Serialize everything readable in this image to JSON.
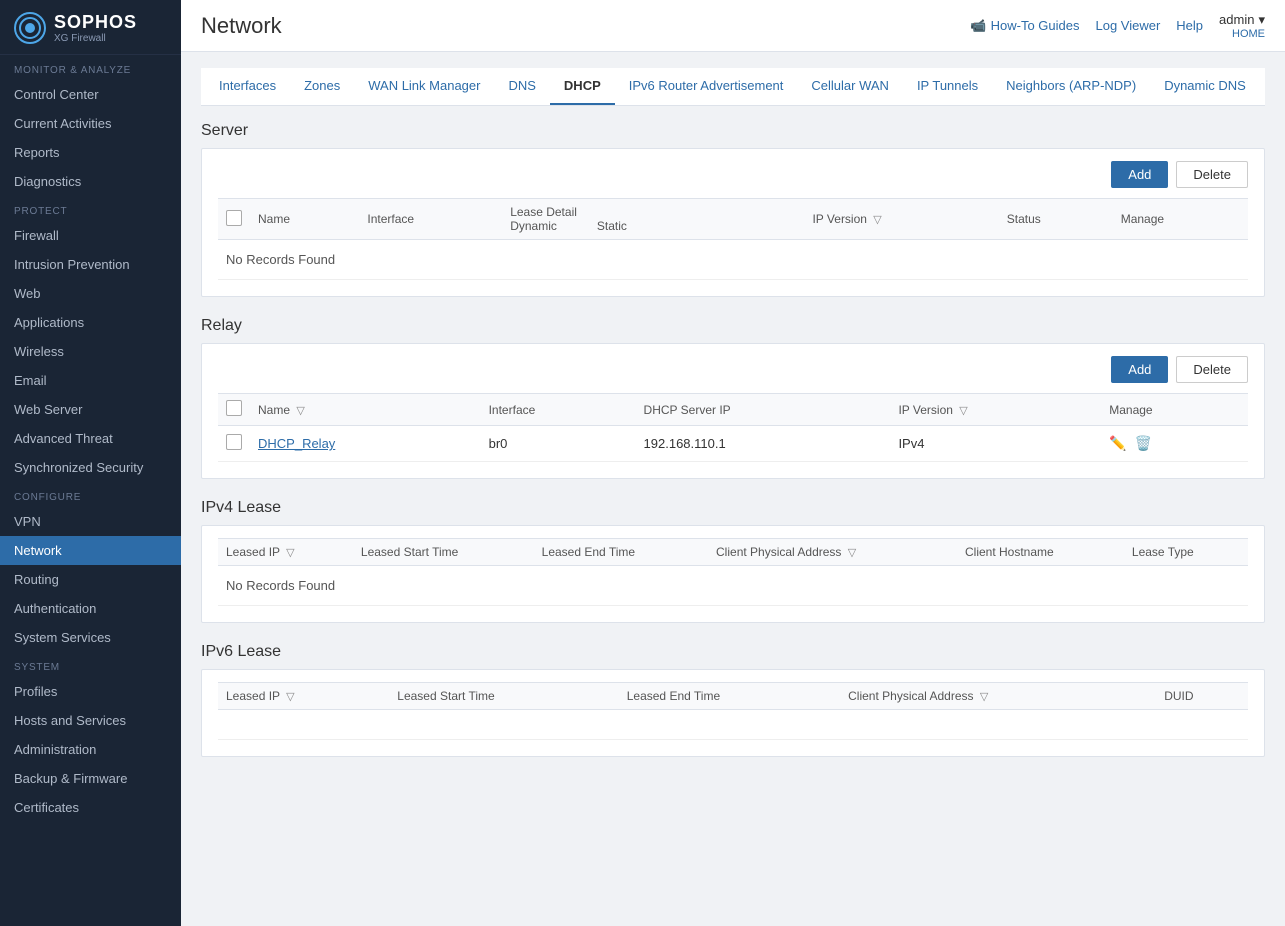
{
  "brand": {
    "name": "SOPHOS",
    "sub": "XG Firewall",
    "icon": "●"
  },
  "topbar": {
    "page_title": "Network",
    "how_to_guides": "How-To Guides",
    "log_viewer": "Log Viewer",
    "help": "Help",
    "admin": "admin",
    "home": "HOME",
    "cam_icon": "📹"
  },
  "sidebar": {
    "sections": [
      {
        "label": "MONITOR & ANALYZE",
        "items": [
          {
            "id": "control-center",
            "label": "Control Center"
          },
          {
            "id": "current-activities",
            "label": "Current Activities"
          },
          {
            "id": "reports",
            "label": "Reports"
          },
          {
            "id": "diagnostics",
            "label": "Diagnostics"
          }
        ]
      },
      {
        "label": "PROTECT",
        "items": [
          {
            "id": "firewall",
            "label": "Firewall"
          },
          {
            "id": "intrusion-prevention",
            "label": "Intrusion Prevention"
          },
          {
            "id": "web",
            "label": "Web"
          },
          {
            "id": "applications",
            "label": "Applications"
          },
          {
            "id": "wireless",
            "label": "Wireless"
          },
          {
            "id": "email",
            "label": "Email"
          },
          {
            "id": "web-server",
            "label": "Web Server"
          },
          {
            "id": "advanced-threat",
            "label": "Advanced Threat"
          },
          {
            "id": "synchronized-security",
            "label": "Synchronized Security"
          }
        ]
      },
      {
        "label": "CONFIGURE",
        "items": [
          {
            "id": "vpn",
            "label": "VPN"
          },
          {
            "id": "network",
            "label": "Network",
            "active": true
          },
          {
            "id": "routing",
            "label": "Routing"
          },
          {
            "id": "authentication",
            "label": "Authentication"
          },
          {
            "id": "system-services",
            "label": "System Services"
          }
        ]
      },
      {
        "label": "SYSTEM",
        "items": [
          {
            "id": "profiles",
            "label": "Profiles"
          },
          {
            "id": "hosts-and-services",
            "label": "Hosts and Services"
          },
          {
            "id": "administration",
            "label": "Administration"
          },
          {
            "id": "backup-firmware",
            "label": "Backup & Firmware"
          },
          {
            "id": "certificates",
            "label": "Certificates"
          }
        ]
      }
    ]
  },
  "tabs": [
    {
      "id": "interfaces",
      "label": "Interfaces"
    },
    {
      "id": "zones",
      "label": "Zones"
    },
    {
      "id": "wan-link-manager",
      "label": "WAN Link Manager"
    },
    {
      "id": "dns",
      "label": "DNS"
    },
    {
      "id": "dhcp",
      "label": "DHCP",
      "active": true
    },
    {
      "id": "ipv6-router",
      "label": "IPv6 Router Advertisement"
    },
    {
      "id": "cellular-wan",
      "label": "Cellular WAN"
    },
    {
      "id": "ip-tunnels",
      "label": "IP Tunnels"
    },
    {
      "id": "neighbors",
      "label": "Neighbors (ARP-NDP)"
    },
    {
      "id": "dynamic-dns",
      "label": "Dynamic DNS"
    }
  ],
  "server": {
    "title": "Server",
    "add_btn": "Add",
    "delete_btn": "Delete",
    "columns": {
      "name": "Name",
      "interface": "Interface",
      "lease_detail": "Lease Detail",
      "dynamic": "Dynamic",
      "static": "Static",
      "ip_version": "IP Version",
      "status": "Status",
      "manage": "Manage"
    },
    "no_records": "No Records Found"
  },
  "relay": {
    "title": "Relay",
    "add_btn": "Add",
    "delete_btn": "Delete",
    "columns": {
      "name": "Name",
      "interface": "Interface",
      "dhcp_server_ip": "DHCP Server IP",
      "ip_version": "IP Version",
      "manage": "Manage"
    },
    "rows": [
      {
        "name": "DHCP_Relay",
        "interface": "br0",
        "dhcp_server_ip": "192.168.110.1",
        "ip_version": "IPv4"
      }
    ]
  },
  "ipv4_lease": {
    "title": "IPv4 Lease",
    "columns": {
      "leased_ip": "Leased IP",
      "leased_start_time": "Leased Start Time",
      "leased_end_time": "Leased End Time",
      "client_physical_address": "Client Physical Address",
      "client_hostname": "Client Hostname",
      "lease_type": "Lease Type"
    },
    "no_records": "No Records Found"
  },
  "ipv6_lease": {
    "title": "IPv6 Lease",
    "columns": {
      "leased_ip": "Leased IP",
      "leased_start_time": "Leased Start Time",
      "leased_end_time": "Leased End Time",
      "client_physical_address": "Client Physical Address",
      "duid": "DUID"
    }
  }
}
